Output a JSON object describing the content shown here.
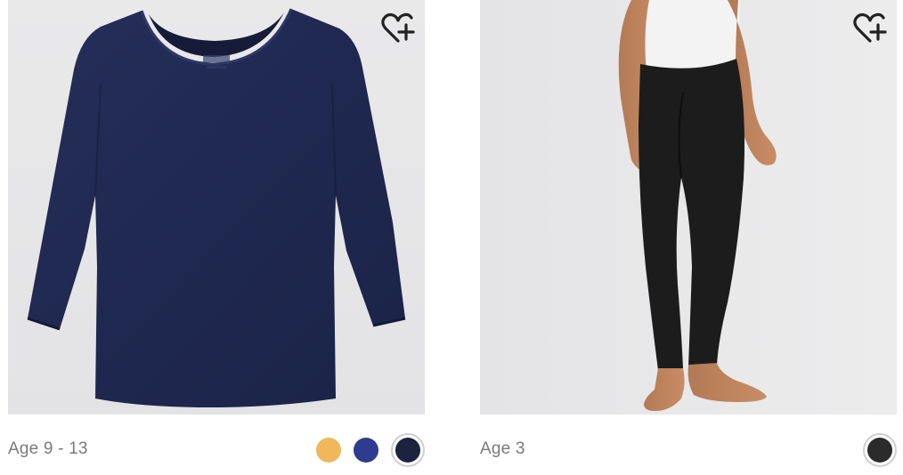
{
  "products": [
    {
      "age_label": "Age 9 - 13",
      "image_icon": "navy-long-sleeve-top",
      "favorite_icon": "heart-plus-icon",
      "swatches": [
        {
          "color": "#f0b85a",
          "selected": false
        },
        {
          "color": "#2e3c8f",
          "selected": false
        },
        {
          "color": "#1c2240",
          "selected": true
        }
      ]
    },
    {
      "age_label": "Age 3",
      "image_icon": "black-leggings",
      "favorite_icon": "heart-plus-icon",
      "swatches": [
        {
          "color": "#2b2b2b",
          "selected": true
        }
      ]
    }
  ]
}
